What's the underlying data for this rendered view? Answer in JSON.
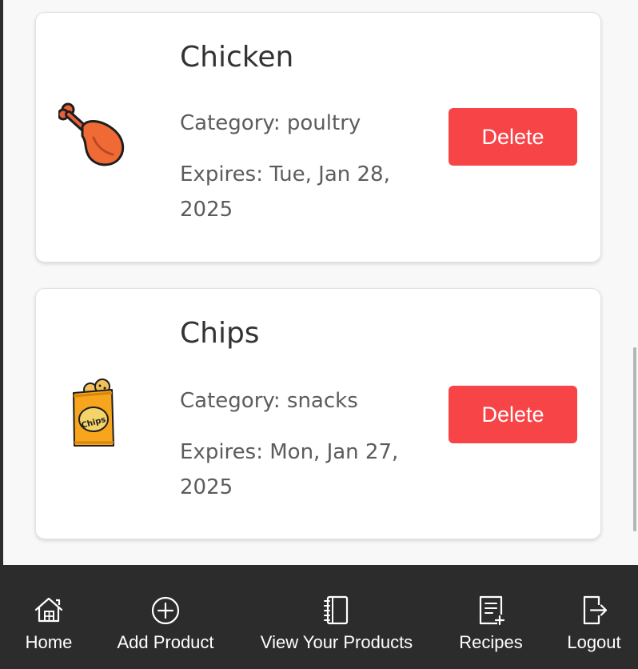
{
  "products": [
    {
      "name": "Chicken",
      "category_text": "Category: poultry",
      "expires_text": "Expires: Tue, Jan 28, 2025",
      "icon": "chicken-leg-icon",
      "delete_label": "Delete"
    },
    {
      "name": "Chips",
      "category_text": "Category: snacks",
      "expires_text": "Expires: Mon, Jan 27, 2025",
      "icon": "chips-bag-icon",
      "icon_text": "Chips",
      "delete_label": "Delete"
    }
  ],
  "nav": {
    "items": [
      {
        "label": "Home",
        "icon": "home-icon"
      },
      {
        "label": "Add Product",
        "icon": "plus-circle-icon"
      },
      {
        "label": "View Your Products",
        "icon": "notebook-icon"
      },
      {
        "label": "Recipes",
        "icon": "recipe-add-icon"
      },
      {
        "label": "Logout",
        "icon": "logout-icon"
      }
    ]
  },
  "colors": {
    "delete_button": "#f74447",
    "nav_background": "#2c2c2c",
    "page_background": "#f8f8f8",
    "card_background": "#ffffff",
    "title_text": "#333333",
    "meta_text": "#5c5c5c"
  }
}
